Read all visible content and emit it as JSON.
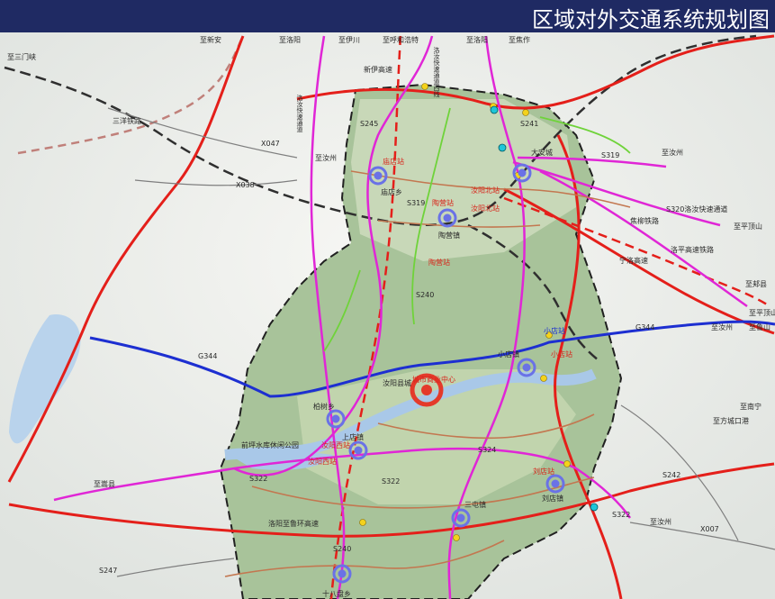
{
  "title": "区域对外交通系统规划图",
  "colors": {
    "header": "#1f2a63",
    "expressway": "#e41f1a",
    "national_road": "#1d2fd1",
    "rail": "#3b3b3b",
    "urban_express": "#e026d6",
    "county_road": "#c37750",
    "green_route": "#6fd33a",
    "station": "#6a72e6",
    "center": "#e43a2a",
    "junction": "#f3d21c"
  },
  "labels": {
    "to_xinan": "至新安",
    "to_luoyang1": "至洛阳",
    "to_yichuan": "至伊川",
    "to_huhehaote": "至呼和浩特",
    "to_luoyang2": "至洛阳",
    "to_jiaozuo": "至焦作",
    "to_sanmenxia": "至三门峡",
    "luoruan_1": "洛汝快速通道西线",
    "luoruan_2": "洛汝快速通道",
    "xinyi_exp": "新伊高速",
    "sanyang_rail": "三洋铁路",
    "s241": "S241",
    "s245": "S245",
    "x047": "X047",
    "x038": "X038",
    "to_ruzhou1": "至汝州",
    "s319_east": "S319",
    "daancheng": "大安城",
    "to_ruzhou2": "至汝州",
    "miaodian_station": "庙店站",
    "miaodian_town": "庙店乡",
    "s319": "S319",
    "ruyangbei_station": "汝阳北站",
    "ruyangbei_station2": "汝阳北站",
    "taoying_station": "陶营站",
    "taoying_town": "陶营镇",
    "s320_line": "S320洛汝快速通道",
    "to_pingdingshan1": "至平顶山",
    "jiaoliu_rail": "焦柳铁路",
    "luoping_hsr": "洛平高速铁路",
    "ningluo_exp": "宁洛高速",
    "taoying_station2": "陶营站",
    "s240": "S240",
    "to_jiaxian": "至郏县",
    "to_pingdingshan2": "至平顶山",
    "to_lushan": "至鲁山",
    "xiaodian_station": "小店站",
    "g344_east": "G344",
    "to_ruzhou3": "至汝州",
    "g344": "G344",
    "xiaodian_town": "小店镇",
    "xiaodian_station2": "小店站",
    "ruyang_county": "汝阳县城",
    "city_center": "城市商业中心",
    "boshu": "柏树乡",
    "to_nanning": "至南宁",
    "to_fangcheng": "至方城口港",
    "shangdian": "上店镇",
    "ruyangxi_station": "汝阳西站",
    "ruyangxi_station2": "汝阳西站",
    "lake_park": "前坪水库休闲公园",
    "s324": "S324",
    "to_songxian": "至嵩县",
    "s322_w": "S322",
    "s322": "S322",
    "s242": "S242",
    "liudian_station": "刘店站",
    "liudian_town": "刘店镇",
    "sanxiang": "三屯镇",
    "s322_e": "S322",
    "to_ruzhou4": "至汝州",
    "x007": "X007",
    "ring_exp": "洛阳至鲁环高速",
    "s247": "S247",
    "s240b": "S240",
    "shiba": "十八盘乡"
  }
}
